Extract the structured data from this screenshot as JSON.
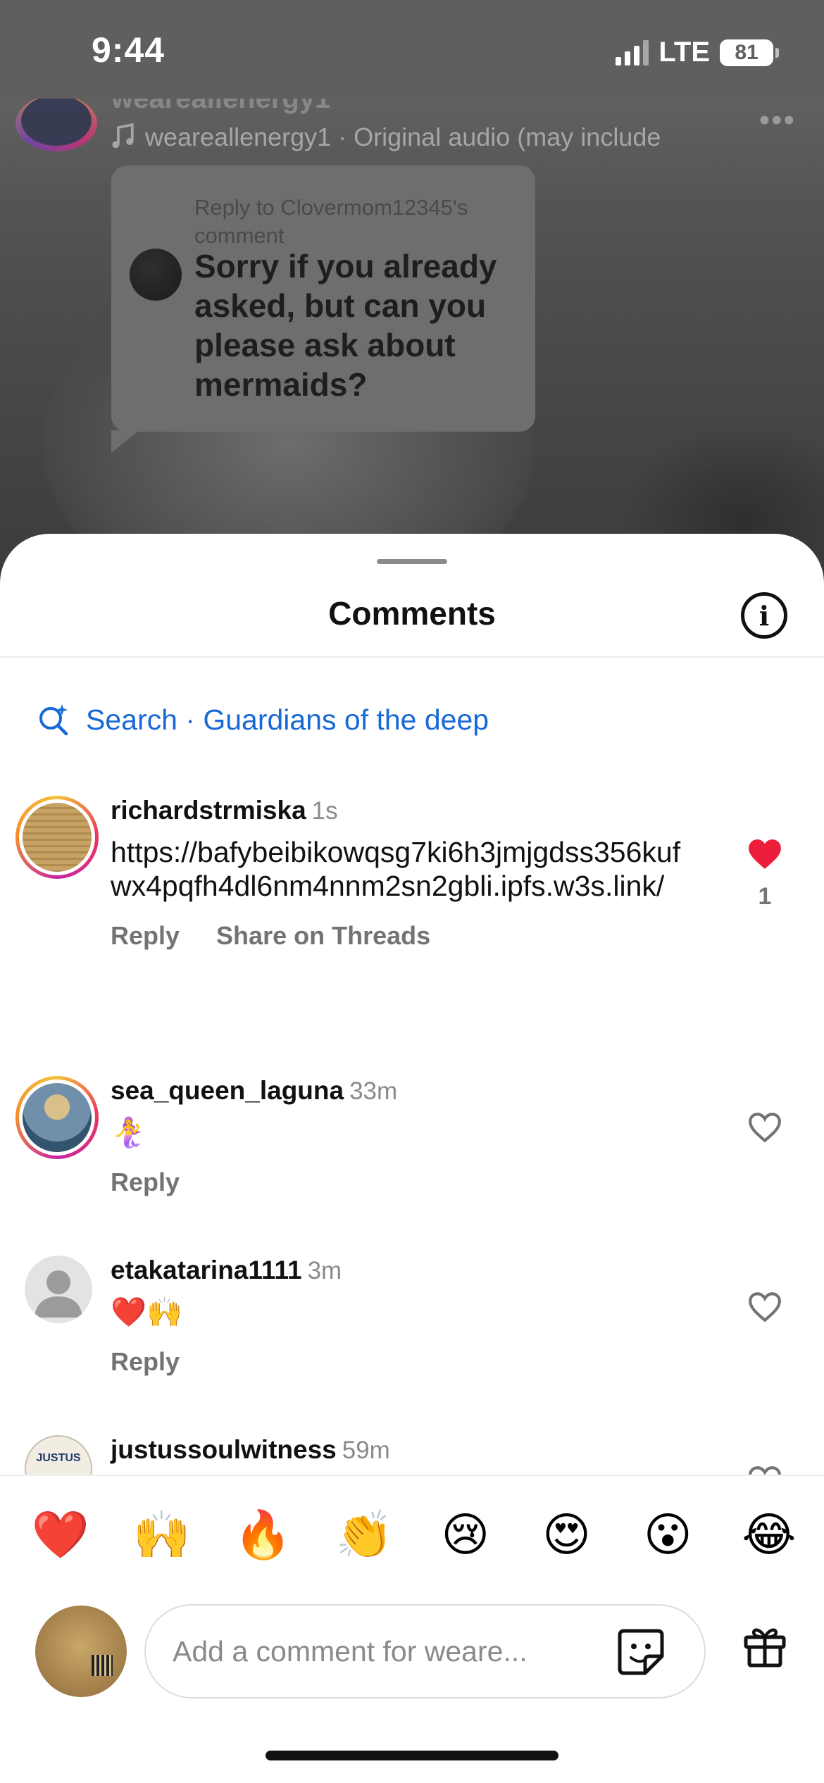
{
  "status_bar": {
    "time": "9:44",
    "network": "LTE",
    "battery": "81"
  },
  "reel": {
    "username": "weareallenergy1",
    "audio": "weareallenergy1 · Original audio  (may include",
    "more_label": "•••",
    "reply_card": {
      "reply_to": "Reply to Clovermom12345's comment",
      "text": "Sorry if you already asked, but can you please ask about mermaids?"
    }
  },
  "sheet": {
    "title": "Comments",
    "info_label": "i",
    "search_label": "Search · Guardians of the deep"
  },
  "comments": [
    {
      "username": "richardstrmiska",
      "time": "1s",
      "text": "https://bafybeibikowqsg7ki6h3jmjgdss356kufwx4pqfh4dl6nm4nnm2sn2gbli.ipfs.w3s.link/",
      "actions": [
        "Reply",
        "Share on Threads"
      ],
      "liked": true,
      "like_count": "1"
    },
    {
      "username": "sea_queen_laguna",
      "time": "33m",
      "text": "🧜‍♀️",
      "actions": [
        "Reply"
      ],
      "liked": false,
      "like_count": ""
    },
    {
      "username": "etakatarina1111",
      "time": "3m",
      "text": "❤️🙌",
      "actions": [
        "Reply"
      ],
      "liked": false,
      "like_count": ""
    },
    {
      "username": "justussoulwitness",
      "time": "59m",
      "text": "",
      "actions": [],
      "liked": false,
      "like_count": ""
    }
  ],
  "avatar_text": {
    "justus": "JUSTUS"
  },
  "quick_emojis": [
    "❤️",
    "🙌",
    "🔥",
    "👏",
    "😢",
    "😍",
    "😮",
    "😂"
  ],
  "composer": {
    "placeholder": "Add a comment for weare..."
  },
  "colors": {
    "accent": "#1769d6",
    "like_red": "#ed1e3c",
    "muted": "#737373"
  }
}
